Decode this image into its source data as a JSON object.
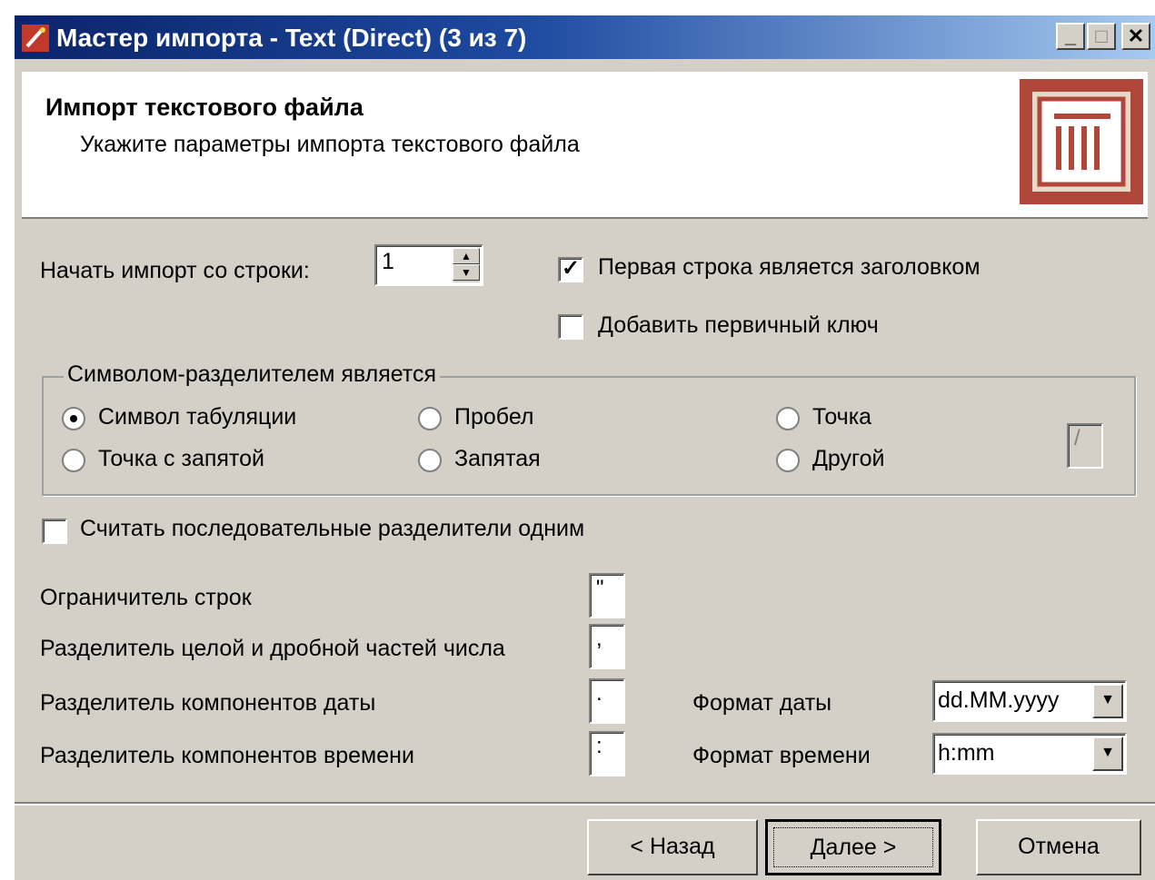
{
  "window": {
    "title": "Мастер импорта - Text (Direct) (3 из 7)",
    "minimize_label": "_",
    "maximize_label": "□",
    "close_label": "✕"
  },
  "header": {
    "title": "Импорт текстового файла",
    "subtitle": "Укажите параметры импорта текстового файла"
  },
  "options": {
    "start_row_label": "Начать импорт со строки:",
    "start_row_value": "1",
    "first_row_header_label": "Первая строка является заголовком",
    "first_row_header_checked": true,
    "add_primary_key_label": "Добавить первичный ключ",
    "add_primary_key_checked": false
  },
  "delimiter": {
    "group_title": "Символом-разделителем является",
    "options": [
      "Символ табуляции",
      "Пробел",
      "Точка",
      "Точка с запятой",
      "Запятая",
      "Другой"
    ],
    "selected": "Символ табуляции",
    "other_value": "/"
  },
  "consecutive": {
    "label": "Считать последовательные разделители одним",
    "checked": false
  },
  "fields": {
    "string_delimiter_label": "Ограничитель строк",
    "string_delimiter_value": "\"",
    "decimal_separator_label": "Разделитель целой и дробной частей числа",
    "decimal_separator_value": ",",
    "date_separator_label": "Разделитель компонентов даты",
    "date_separator_value": ".",
    "time_separator_label": "Разделитель компонентов времени",
    "time_separator_value": ":",
    "date_format_label": "Формат даты",
    "date_format_value": "dd.MM.yyyy",
    "time_format_label": "Формат времени",
    "time_format_value": "h:mm"
  },
  "buttons": {
    "back": "< Назад",
    "next": "Далее >",
    "cancel": "Отмена"
  },
  "colors": {
    "title_bar_start": "#0a246a",
    "title_bar_end": "#a6caf0",
    "dialog_bg": "#d4d0c8",
    "logo_accent": "#b0473b"
  }
}
